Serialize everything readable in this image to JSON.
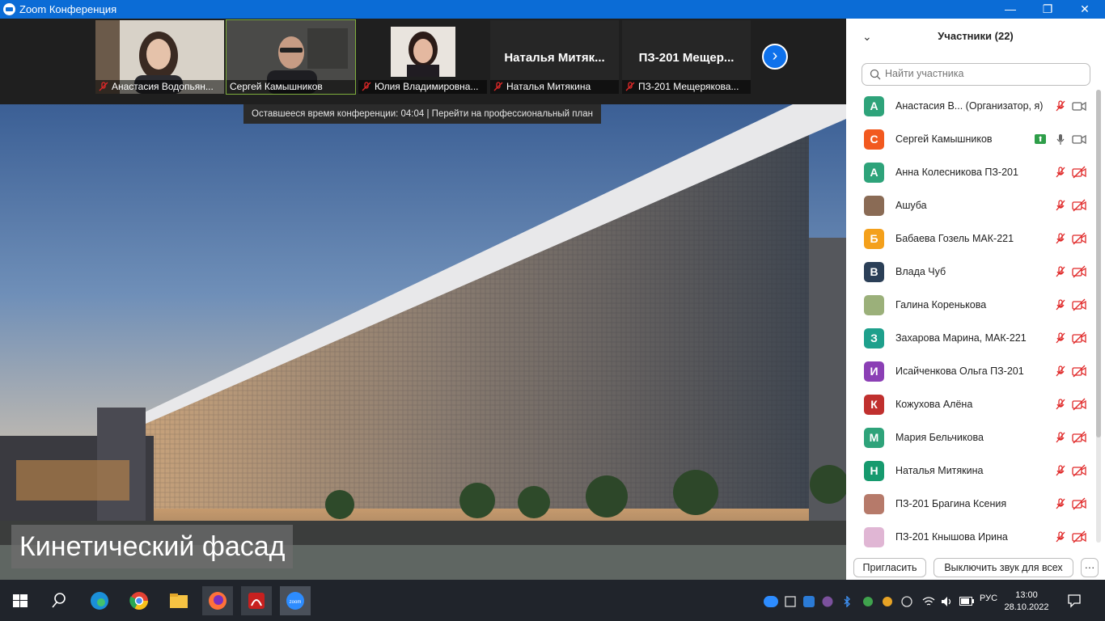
{
  "window": {
    "title": "Zoom Конференция"
  },
  "strip": {
    "tiles": [
      {
        "label": "Анастасия Водопьян...",
        "muted": true,
        "type": "video"
      },
      {
        "label": "Сергей Камышников",
        "muted": false,
        "type": "video"
      },
      {
        "label": "Юлия Владимировна...",
        "muted": true,
        "type": "photo"
      },
      {
        "name": "Наталья  Митяк...",
        "label": "Наталья Митякина",
        "muted": true,
        "type": "name"
      },
      {
        "name": "ПЗ-201  Мещер...",
        "label": "ПЗ-201 Мещерякова...",
        "muted": true,
        "type": "name"
      }
    ],
    "tooltip": "Оставшееся время конференции: 04:04 | Перейти на профессиональный план"
  },
  "screen": {
    "caption": "Кинетический фасад"
  },
  "panel": {
    "title": "Участники (22)",
    "search_placeholder": "Найти участника",
    "participants": [
      {
        "initial": "А",
        "color": "#2ea37a",
        "name": "Анастасия В...  (Организатор, я)",
        "mic": "muted",
        "video": "on"
      },
      {
        "initial": "С",
        "color": "#f2591f",
        "name": "Сергей Камышников",
        "mic": "on",
        "video": "on",
        "share": true
      },
      {
        "initial": "А",
        "color": "#2ea37a",
        "name": "Анна Колесникова ПЗ-201",
        "mic": "muted",
        "video": "off"
      },
      {
        "initial": "",
        "color": "#8a6b55",
        "name": "Ашуба",
        "mic": "muted",
        "video": "off",
        "photo": true
      },
      {
        "initial": "Б",
        "color": "#f4a01b",
        "name": "Бабаева Гозель МАК-221",
        "mic": "muted",
        "video": "off"
      },
      {
        "initial": "В",
        "color": "#2b3f57",
        "name": "Влада Чуб",
        "mic": "muted",
        "video": "off"
      },
      {
        "initial": "",
        "color": "#9bb07a",
        "name": "Галина Коренькова",
        "mic": "muted",
        "video": "off",
        "photo": true
      },
      {
        "initial": "З",
        "color": "#1ea08c",
        "name": "Захарова Марина, МАК-221",
        "mic": "muted",
        "video": "off"
      },
      {
        "initial": "И",
        "color": "#8b3fb5",
        "name": "Исайченкова Ольга ПЗ-201",
        "mic": "muted",
        "video": "off"
      },
      {
        "initial": "К",
        "color": "#c0302e",
        "name": "Кожухова Алёна",
        "mic": "muted",
        "video": "off"
      },
      {
        "initial": "М",
        "color": "#2ea37a",
        "name": "Мария Бельчикова",
        "mic": "muted",
        "video": "off"
      },
      {
        "initial": "Н",
        "color": "#169a6e",
        "name": "Наталья Митякина",
        "mic": "muted",
        "video": "off"
      },
      {
        "initial": "",
        "color": "#b67a6a",
        "name": "ПЗ-201 Брагина Ксения",
        "mic": "muted",
        "video": "off",
        "photo": true
      },
      {
        "initial": "",
        "color": "#e0b6d4",
        "name": "ПЗ-201 Кнышова Ирина",
        "mic": "muted",
        "video": "off"
      }
    ],
    "invite_label": "Пригласить",
    "mute_all_label": "Выключить звук для всех",
    "more_label": "···"
  },
  "taskbar": {
    "lang": "РУС",
    "time": "13:00",
    "date": "28.10.2022",
    "zoom_icon_text": "zoom"
  },
  "colors": {
    "accent": "#0e71eb",
    "titlebar": "#0b6cd6",
    "muted_red": "#e02828"
  }
}
